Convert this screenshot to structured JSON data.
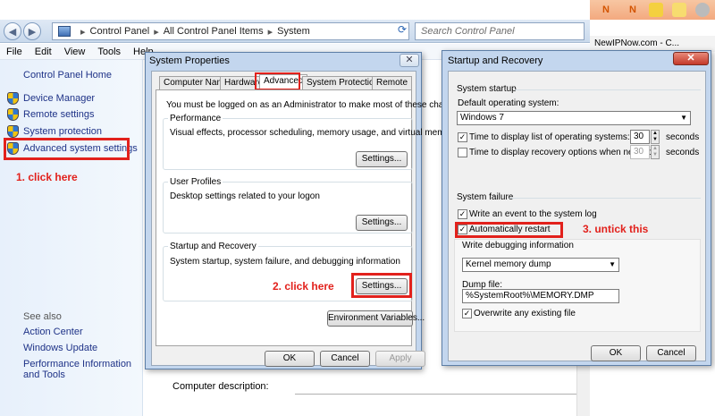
{
  "address_bar": {
    "crumbs": [
      "Control Panel",
      "All Control Panel Items",
      "System"
    ],
    "search_placeholder": "Search Control Panel"
  },
  "menu": [
    "File",
    "Edit",
    "View",
    "Tools",
    "Help"
  ],
  "left_pane": {
    "home": "Control Panel Home",
    "links": [
      "Device Manager",
      "Remote settings",
      "System protection",
      "Advanced system settings"
    ],
    "see_also_header": "See also",
    "see_also": [
      "Action Center",
      "Windows Update",
      "Performance Information and Tools"
    ]
  },
  "annotations": {
    "click_here_1": "1. click here",
    "click_here_2": "2. click here",
    "untick_this": "3. untick this",
    "highlight_color": "#e2211c"
  },
  "background": {
    "computer_description": "Computer description:"
  },
  "browser": {
    "bookmark_text": "NewIPNow.com - C..."
  },
  "system_properties": {
    "title": "System Properties",
    "close": "✕",
    "tabs": [
      "Computer Name",
      "Hardware",
      "Advanced",
      "System Protection",
      "Remote"
    ],
    "admin_note": "You must be logged on as an Administrator to make most of these changes.",
    "performance": {
      "label": "Performance",
      "desc": "Visual effects, processor scheduling, memory usage, and virtual memory",
      "button": "Settings..."
    },
    "user_profiles": {
      "label": "User Profiles",
      "desc": "Desktop settings related to your logon",
      "button": "Settings..."
    },
    "startup_recovery": {
      "label": "Startup and Recovery",
      "desc": "System startup, system failure, and debugging information",
      "button": "Settings..."
    },
    "env_button": "Environment Variables...",
    "ok": "OK",
    "cancel": "Cancel",
    "apply": "Apply"
  },
  "startup_recovery_dialog": {
    "title": "Startup and Recovery",
    "close": "✕",
    "system_startup_label": "System startup",
    "default_os_label": "Default operating system:",
    "default_os_value": "Windows 7",
    "time_list_label": "Time to display list of operating systems:",
    "time_list_value": "30",
    "time_list_checked": true,
    "time_recovery_label": "Time to display recovery options when needed:",
    "time_recovery_value": "30",
    "time_recovery_checked": false,
    "seconds": "seconds",
    "system_failure_label": "System failure",
    "write_event_label": "Write an event to the system log",
    "write_event_checked": true,
    "auto_restart_label": "Automatically restart",
    "auto_restart_checked": true,
    "write_debug_label": "Write debugging information",
    "debug_type": "Kernel memory dump",
    "dump_file_label": "Dump file:",
    "dump_file_value": "%SystemRoot%\\MEMORY.DMP",
    "overwrite_label": "Overwrite any existing file",
    "overwrite_checked": true,
    "ok": "OK",
    "cancel": "Cancel"
  }
}
